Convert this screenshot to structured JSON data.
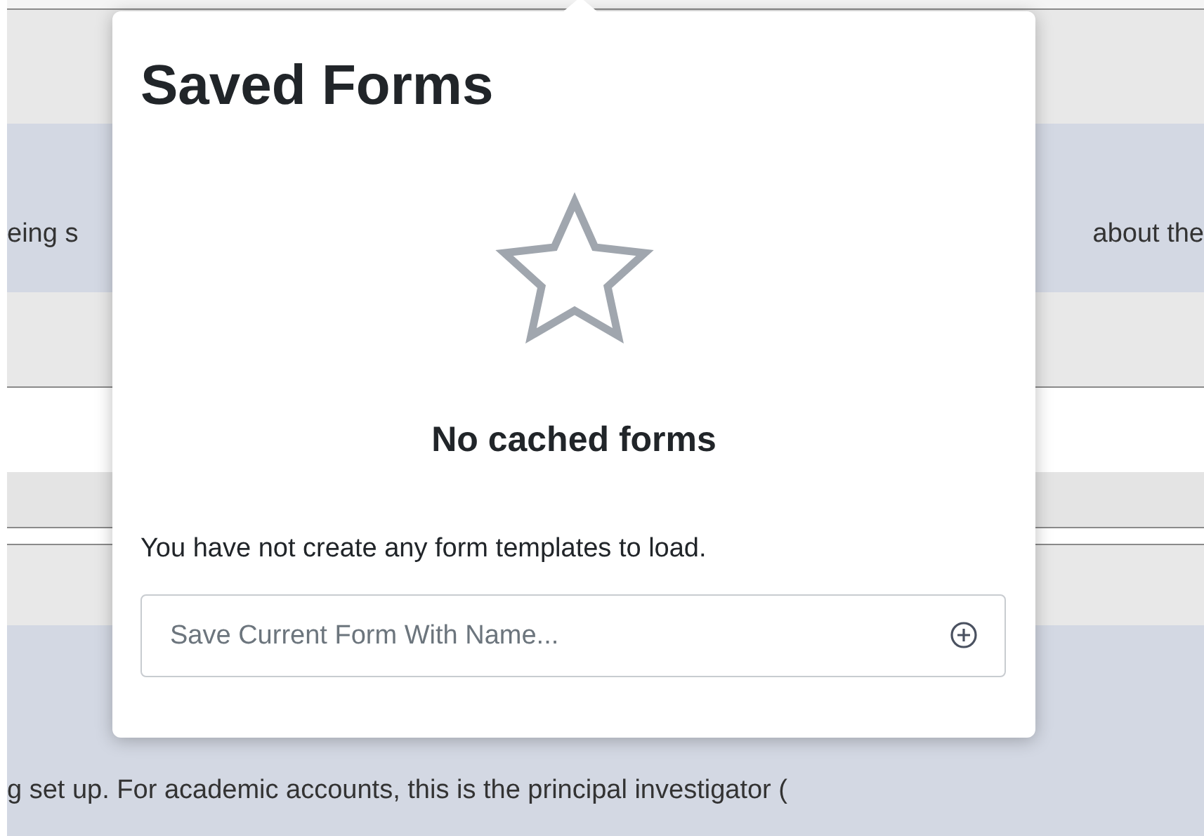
{
  "background": {
    "band_left_text": "eing s",
    "band_right_text": "about the",
    "paragraph": "g set up. For academic accounts, this is the principal investigator ("
  },
  "popover": {
    "title": "Saved Forms",
    "empty_title": "No cached forms",
    "empty_message": "You have not create any form templates to load.",
    "name_field": {
      "placeholder": "Save Current Form With Name..."
    }
  }
}
